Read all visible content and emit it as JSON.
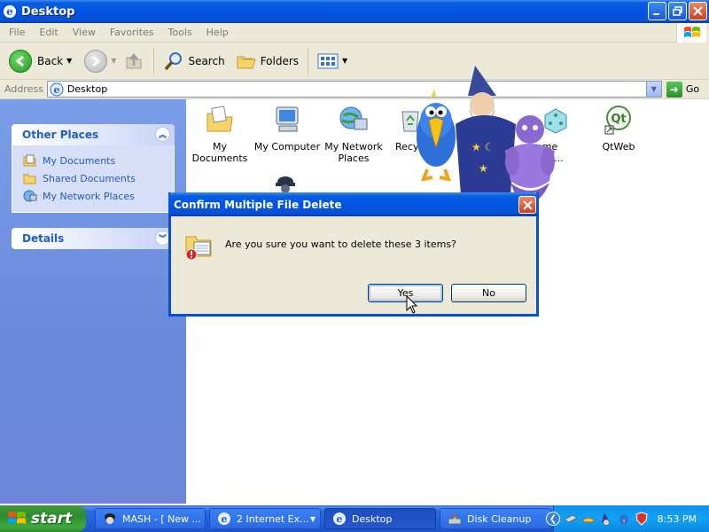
{
  "window": {
    "title": "Desktop"
  },
  "menubar": {
    "items": [
      "File",
      "Edit",
      "View",
      "Favorites",
      "Tools",
      "Help"
    ]
  },
  "toolbar": {
    "back_label": "Back",
    "search_label": "Search",
    "folders_label": "Folders"
  },
  "address": {
    "label": "Address",
    "value": "Desktop",
    "go_label": "Go"
  },
  "sidebar": {
    "other_places": {
      "title": "Other Places",
      "items": [
        {
          "label": "My Documents",
          "icon": "my-documents-icon"
        },
        {
          "label": "Shared Documents",
          "icon": "folder-icon"
        },
        {
          "label": "My Network Places",
          "icon": "network-places-icon"
        }
      ]
    },
    "details": {
      "title": "Details"
    }
  },
  "desktop_items": [
    {
      "label": "My Documents",
      "icon": "my-documents-icon"
    },
    {
      "label": "My Computer",
      "icon": "my-computer-icon"
    },
    {
      "label": "My Network Places",
      "icon": "network-places-icon"
    },
    {
      "label": "Recy",
      "icon": "recycle-bin-icon"
    },
    {
      "label": "ame ecti...",
      "icon": "game-icon"
    },
    {
      "label": "QtWeb",
      "icon": "qtweb-icon"
    }
  ],
  "dialog": {
    "title": "Confirm Multiple File Delete",
    "message": "Are you sure you want to delete these 3 items?",
    "yes_label": "Yes",
    "no_label": "No"
  },
  "taskbar": {
    "start_label": "start",
    "tasks": [
      {
        "label": "MASH - [ New ...",
        "icon": "mash-icon"
      },
      {
        "label": "2 Internet Ex...",
        "icon": "ie-icon"
      },
      {
        "label": "Desktop",
        "icon": "ie-icon"
      },
      {
        "label": "Disk Cleanup",
        "icon": "disk-cleanup-icon"
      }
    ],
    "clock": "8:53 PM"
  },
  "colors": {
    "xp_blue": "#0055e5",
    "task_pane": "#7b9ee8",
    "start_green": "#3c9a3c",
    "tray_blue": "#12a2f5"
  }
}
